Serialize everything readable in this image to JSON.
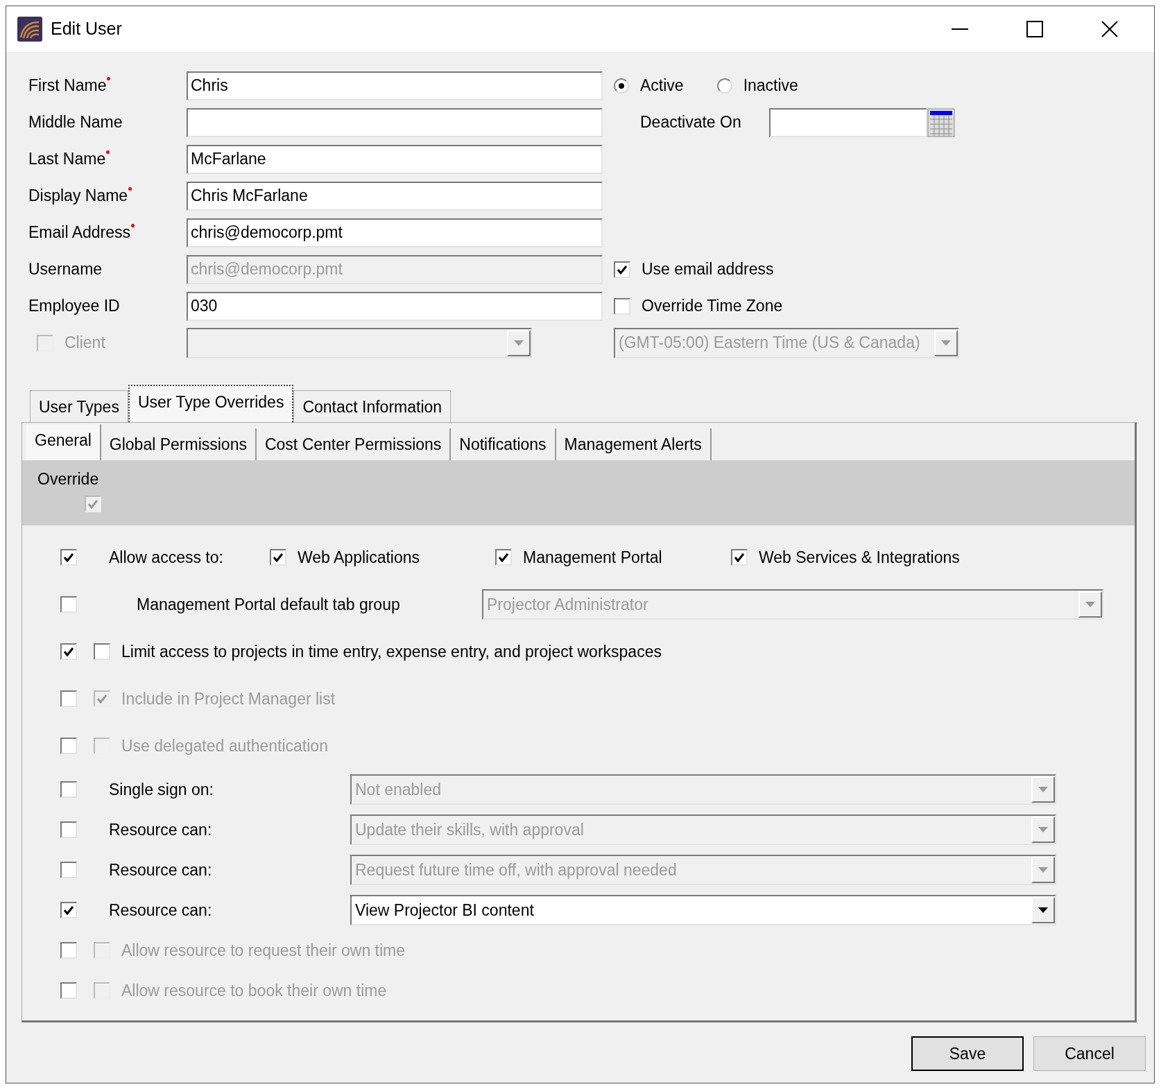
{
  "window": {
    "title": "Edit User"
  },
  "fields": [
    {
      "kind": "text",
      "label": "First Name",
      "required": true,
      "value": "Chris",
      "disabled": false
    },
    {
      "kind": "text",
      "label": "Middle Name",
      "required": false,
      "disabled": false
    },
    {
      "kind": "text",
      "label": "Last Name",
      "required": true,
      "value": "McFarlane",
      "disabled": false
    },
    {
      "kind": "text",
      "label": "Display Name",
      "required": true,
      "value": "Chris McFarlane",
      "disabled": false
    },
    {
      "kind": "text",
      "label": "Email Address",
      "required": true,
      "value": "chris@democorp.pmt",
      "disabled": false
    },
    {
      "kind": "text",
      "label": "Username",
      "required": false,
      "value": "chris@democorp.pmt",
      "disabled": true
    },
    {
      "kind": "text",
      "label": "Employee ID",
      "required": false,
      "value": "030",
      "disabled": false
    },
    {
      "kind": "check-dropdown",
      "label": "Client",
      "checked": false,
      "disabled": true
    }
  ],
  "status": [
    {
      "label": "Active",
      "selected": true
    },
    {
      "label": "Inactive",
      "selected": false
    }
  ],
  "deactivate_on": {
    "label": "Deactivate On"
  },
  "use_email": {
    "label": "Use email address",
    "checked": true
  },
  "override_time_zone": {
    "label": "Override Time Zone",
    "checked": false
  },
  "time_zone": {
    "value": "(GMT-05:00) Eastern Time (US & Canada)",
    "disabled": true
  },
  "outer_tabs": [
    {
      "label": "User Types",
      "selected": false
    },
    {
      "label": "User Type Overrides",
      "selected": true
    },
    {
      "label": "Contact Information",
      "selected": false
    }
  ],
  "inner_tabs": [
    {
      "label": "General",
      "selected": true
    },
    {
      "label": "Global Permissions",
      "selected": false
    },
    {
      "label": "Cost Center Permissions",
      "selected": false
    },
    {
      "label": "Notifications",
      "selected": false
    },
    {
      "label": "Management Alerts",
      "selected": false
    }
  ],
  "override": {
    "label": "Override",
    "checked": true,
    "disabled": true
  },
  "rows": [
    {
      "kind": "access",
      "checked": true,
      "label": "Allow access to:",
      "options": [
        {
          "label": "Web Applications",
          "checked": true
        },
        {
          "label": "Management Portal",
          "checked": true
        },
        {
          "label": "Web Services & Integrations",
          "checked": true
        }
      ]
    },
    {
      "kind": "tab-group",
      "checked": false,
      "label": "Management Portal default tab group",
      "value": "Projector Administrator",
      "disabled": true
    },
    {
      "kind": "check",
      "checked": true,
      "label": "Limit access to projects in time entry, expense entry, and project workspaces",
      "inner_checked": false,
      "disabled": false
    },
    {
      "kind": "check",
      "checked": false,
      "label": "Include in Project Manager list",
      "inner_checked": true,
      "disabled": true
    },
    {
      "kind": "check",
      "checked": false,
      "label": "Use delegated authentication",
      "inner_checked": false,
      "disabled": true
    },
    {
      "kind": "dropdown",
      "checked": false,
      "label": "Single sign on:",
      "value": "Not enabled",
      "disabled": true
    },
    {
      "kind": "dropdown",
      "checked": false,
      "label": "Resource can:",
      "value": "Update their skills, with approval",
      "disabled": true
    },
    {
      "kind": "dropdown",
      "checked": false,
      "label": "Resource can:",
      "value": "Request future time off, with approval needed",
      "disabled": true
    },
    {
      "kind": "dropdown",
      "checked": true,
      "label": "Resource can:",
      "value": "View Projector BI content",
      "disabled": false
    },
    {
      "kind": "check",
      "checked": false,
      "label": "Allow resource to request their own time",
      "inner_checked": false,
      "disabled": true
    },
    {
      "kind": "check",
      "checked": false,
      "label": "Allow resource to book their own time",
      "inner_checked": false,
      "disabled": true
    }
  ],
  "buttons": [
    {
      "label": "Save",
      "default": true
    },
    {
      "label": "Cancel",
      "default": false
    }
  ]
}
